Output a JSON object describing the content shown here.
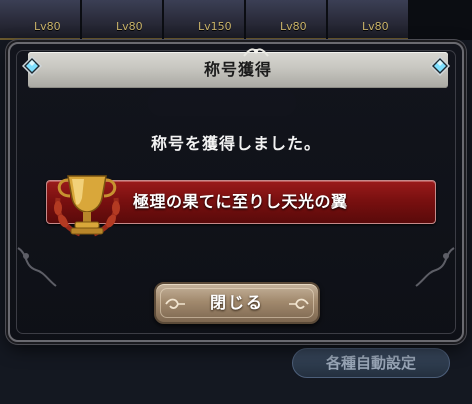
{
  "background": {
    "party_levels": [
      "Lv80",
      "Lv80",
      "Lv150",
      "Lv80",
      "Lv80"
    ],
    "auto_settings_button": "各種自動設定"
  },
  "dialog": {
    "header": "称号獲得",
    "message": "称号を獲得しました。",
    "earned_title": "極理の果てに至りし天光の翼",
    "close_button": "閉じる"
  },
  "colors": {
    "banner_red": "#7a1010",
    "header_silver": "#c7c6c0",
    "button_tan": "#a28a6e",
    "gem_cyan": "#7fe0ff",
    "trophy_gold": "#d9a73a"
  },
  "icons": [
    "trophy-icon",
    "gem-icon",
    "flourish-ornament"
  ]
}
